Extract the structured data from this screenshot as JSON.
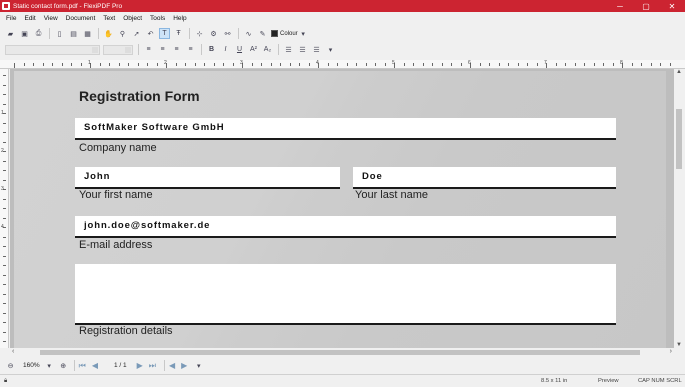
{
  "window": {
    "title": "Static contact form.pdf - FlexiPDF Pro",
    "minimize": "─",
    "maximize": "▢",
    "close": "✕"
  },
  "menu": [
    "File",
    "Edit",
    "View",
    "Document",
    "Text",
    "Object",
    "Tools",
    "Help"
  ],
  "toolbar": {
    "colour_label": "Colour"
  },
  "form": {
    "title": "Registration Form",
    "company_value": "SoftMaker Software GmbH",
    "company_label": "Company name",
    "first_value": "John",
    "first_label": "Your first name",
    "last_value": "Doe",
    "last_label": "Your last name",
    "email_value": "john.doe@softmaker.de",
    "email_label": "E-mail address",
    "details_value": "",
    "details_label": "Registration details"
  },
  "navigation": {
    "zoom": "160%",
    "page": "1 / 1"
  },
  "status": {
    "page_size": "8.5 x 11 in",
    "mode": "Preview",
    "indicators": "CAP NUM SCRL"
  },
  "ruler": {
    "h_numbers": [
      "1",
      "2",
      "3",
      "4",
      "5",
      "6",
      "7",
      "8"
    ],
    "v_numbers": [
      "1",
      "2",
      "3",
      "4"
    ]
  }
}
